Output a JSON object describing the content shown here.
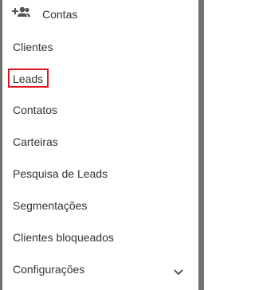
{
  "menu": {
    "header": {
      "label": "Contas",
      "icon": "person-add-icon"
    },
    "items": [
      {
        "label": "Clientes"
      },
      {
        "label": "Leads",
        "highlighted": true
      },
      {
        "label": "Contatos"
      },
      {
        "label": "Carteiras"
      },
      {
        "label": "Pesquisa de Leads"
      },
      {
        "label": "Segmentações"
      },
      {
        "label": "Clientes bloqueados"
      },
      {
        "label": "Configurações",
        "icon": "chevron-down-icon"
      }
    ]
  },
  "colors": {
    "text": "#333333",
    "highlight_border": "#e0141e",
    "side_bar": "#707070"
  }
}
